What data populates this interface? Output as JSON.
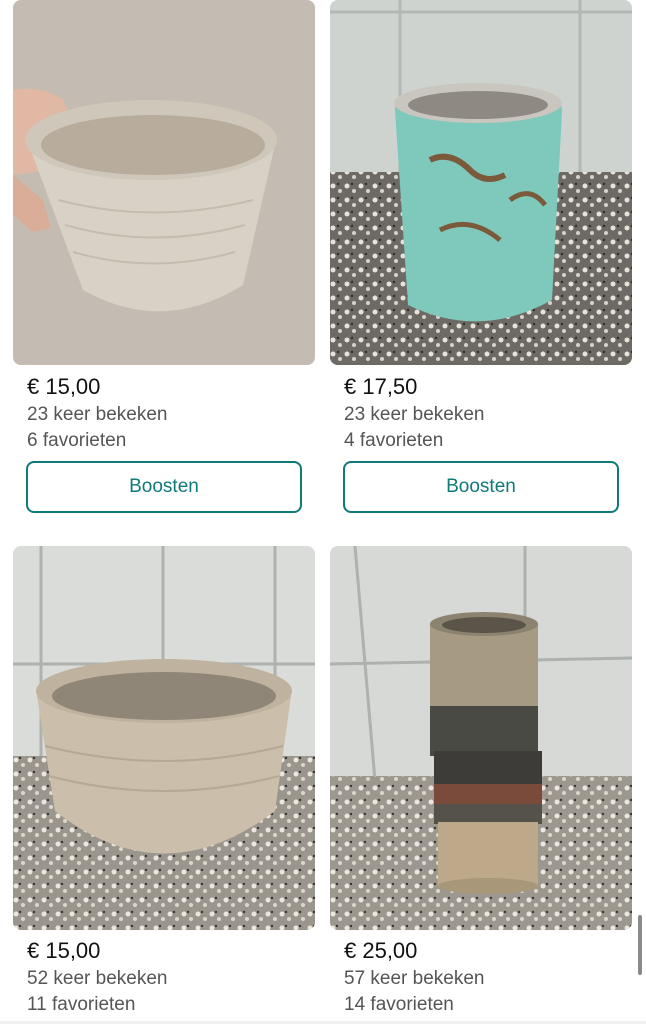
{
  "listings": [
    {
      "price": "€ 15,00",
      "views": "23 keer bekeken",
      "favorites": "6 favorieten",
      "boost_label": "Boosten",
      "image": "cream-ceramic-bowl-held-in-hand"
    },
    {
      "price": "€ 17,50",
      "views": "23 keer bekeken",
      "favorites": "4 favorieten",
      "boost_label": "Boosten",
      "image": "turquoise-ceramic-vase-on-terrazzo"
    },
    {
      "price": "€ 15,00",
      "views": "52 keer bekeken",
      "favorites": "11 favorieten",
      "image": "beige-ceramic-pot-on-terrazzo"
    },
    {
      "price": "€ 25,00",
      "views": "57 keer bekeken",
      "favorites": "14 favorieten",
      "image": "brown-striped-ceramic-vase-on-terrazzo"
    }
  ],
  "colors": {
    "accent": "#0f7a7a",
    "price_text": "#111111",
    "meta_text": "#555555"
  }
}
